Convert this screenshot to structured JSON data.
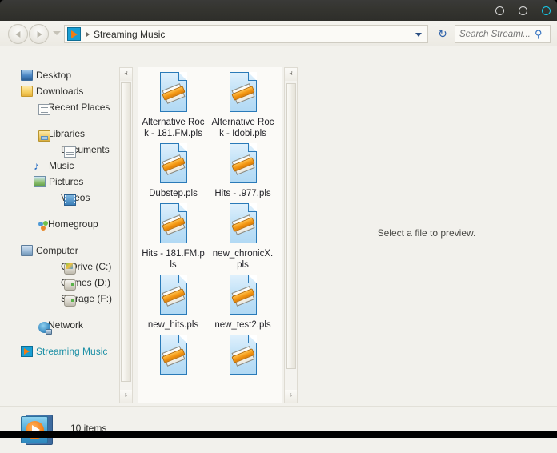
{
  "window": {
    "controls": [
      {
        "name": "minimize",
        "icon": "circle-icon",
        "accent": false
      },
      {
        "name": "maximize",
        "icon": "circle-icon",
        "accent": false
      },
      {
        "name": "close",
        "icon": "circle-icon",
        "accent": true
      }
    ],
    "accent_color": "#16c8e8",
    "titlebar_color": "#34342f"
  },
  "nav": {
    "back_label": "Back",
    "forward_label": "Forward",
    "recent_label": "Recent pages",
    "address": {
      "icon": "media-play-icon",
      "path": "Streaming Music",
      "separator": "›",
      "dropdown_label": "Previous locations"
    },
    "refresh_label": "Refresh",
    "refresh_glyph": "↻"
  },
  "search": {
    "placeholder": "Search Streami...",
    "value": "",
    "icon": "search-icon",
    "glyph": "⚲"
  },
  "sidebar": {
    "items": [
      {
        "label": "Desktop",
        "icon": "monitor-icon",
        "indent": false,
        "gap_before": false,
        "selected": false
      },
      {
        "label": "Downloads",
        "icon": "downloads-folder-icon",
        "indent": false,
        "gap_before": false,
        "selected": false
      },
      {
        "label": "Recent Places",
        "icon": "recent-places-icon",
        "indent": false,
        "gap_before": false,
        "selected": false
      },
      {
        "label": "Libraries",
        "icon": "libraries-folder-icon",
        "indent": false,
        "gap_before": true,
        "selected": false
      },
      {
        "label": "Documents",
        "icon": "document-icon",
        "indent": true,
        "gap_before": false,
        "selected": false
      },
      {
        "label": "Music",
        "icon": "music-note-icon",
        "indent": true,
        "gap_before": false,
        "selected": false
      },
      {
        "label": "Pictures",
        "icon": "picture-icon",
        "indent": true,
        "gap_before": false,
        "selected": false
      },
      {
        "label": "Videos",
        "icon": "video-icon",
        "indent": true,
        "gap_before": false,
        "selected": false
      },
      {
        "label": "Homegroup",
        "icon": "homegroup-icon",
        "indent": false,
        "gap_before": true,
        "selected": false
      },
      {
        "label": "Computer",
        "icon": "computer-icon",
        "indent": false,
        "gap_before": true,
        "selected": false
      },
      {
        "label": "C Drive (C:)",
        "icon": "system-drive-icon",
        "indent": true,
        "gap_before": false,
        "selected": false
      },
      {
        "label": "Games (D:)",
        "icon": "drive-icon",
        "indent": true,
        "gap_before": false,
        "selected": false
      },
      {
        "label": "Storage (F:)",
        "icon": "drive-icon",
        "indent": true,
        "gap_before": false,
        "selected": false
      },
      {
        "label": "Network",
        "icon": "network-icon",
        "indent": false,
        "gap_before": true,
        "selected": false
      },
      {
        "label": "Streaming Music",
        "icon": "media-play-icon",
        "indent": false,
        "gap_before": true,
        "selected": true
      }
    ],
    "selected_color": "#1b8fa5"
  },
  "files": {
    "items": [
      {
        "name": "Alternative Rock - 181.FM.pls",
        "icon": "playlist-file-icon"
      },
      {
        "name": "Alternative Rock - Idobi.pls",
        "icon": "playlist-file-icon"
      },
      {
        "name": "Dubstep.pls",
        "icon": "playlist-file-icon"
      },
      {
        "name": "Hits - .977.pls",
        "icon": "playlist-file-icon"
      },
      {
        "name": "Hits - 181.FM.pls",
        "icon": "playlist-file-icon"
      },
      {
        "name": "new_chronicX.pls",
        "icon": "playlist-file-icon"
      },
      {
        "name": "new_hits.pls",
        "icon": "playlist-file-icon"
      },
      {
        "name": "new_test2.pls",
        "icon": "playlist-file-icon"
      },
      {
        "name": "",
        "icon": "playlist-file-icon"
      },
      {
        "name": "",
        "icon": "playlist-file-icon"
      }
    ]
  },
  "preview": {
    "message": "Select a file to preview."
  },
  "status": {
    "icon": "media-library-icon",
    "text": "10 items"
  },
  "scrollbars": {
    "up_glyph": "ⱏ",
    "down_glyph": "ⱛ"
  }
}
